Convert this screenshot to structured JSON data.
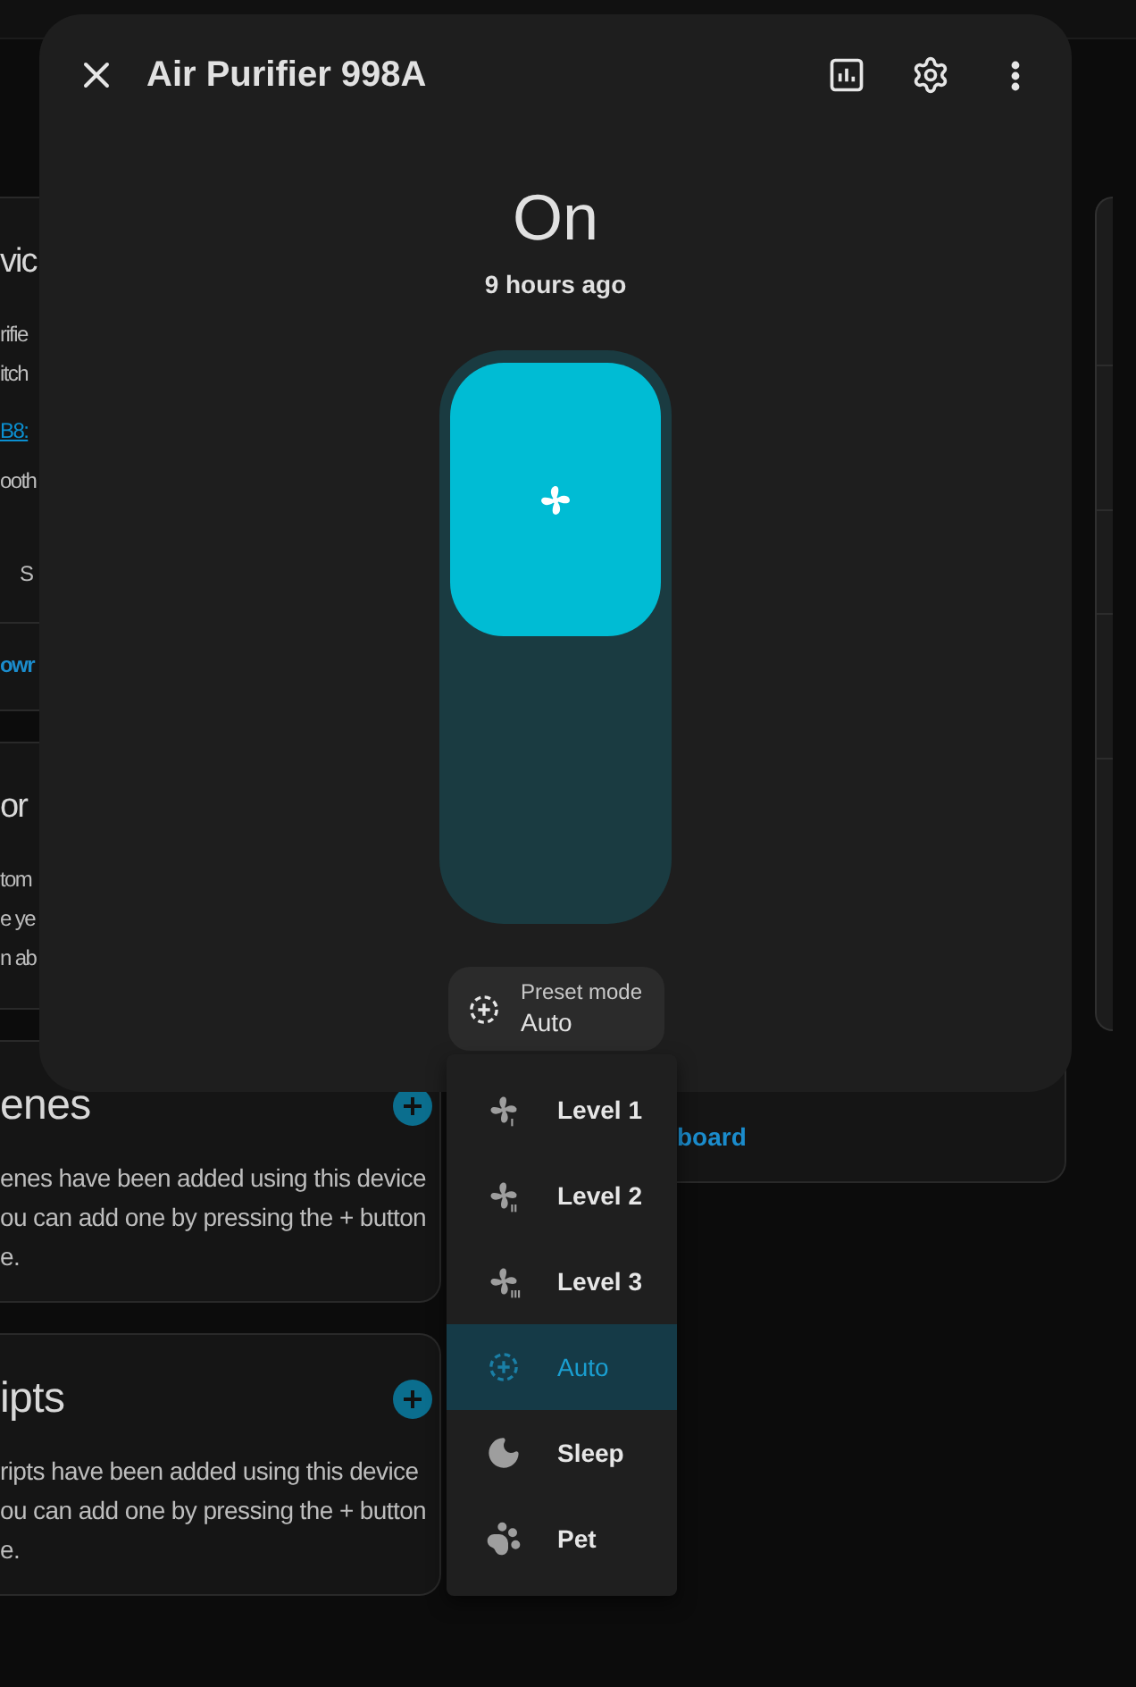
{
  "dialog": {
    "title": "Air Purifier 998A"
  },
  "state": {
    "value": "On",
    "changed": "9 hours ago"
  },
  "control": {
    "on": true
  },
  "preset": {
    "label": "Preset mode",
    "value": "Auto"
  },
  "preset_menu": {
    "items": [
      {
        "label": "Level 1",
        "kind": "speed1",
        "selected": false
      },
      {
        "label": "Level 2",
        "kind": "speed2",
        "selected": false
      },
      {
        "label": "Level 3",
        "kind": "speed3",
        "selected": false
      },
      {
        "label": "Auto",
        "kind": "auto",
        "selected": true
      },
      {
        "label": "Sleep",
        "kind": "sleep",
        "selected": false
      },
      {
        "label": "Pet",
        "kind": "pet",
        "selected": false
      }
    ]
  },
  "background": {
    "left_cards": [
      {
        "heading": "vic",
        "lines": [
          {
            "kind": "text",
            "text": "rifie"
          },
          {
            "kind": "text",
            "text": "itch"
          },
          {
            "kind": "link",
            "text": "B8:"
          },
          {
            "kind": "text",
            "text": "ooth"
          },
          {
            "kind": "label",
            "text": "S"
          }
        ],
        "action": "owr"
      },
      {
        "heading": "or",
        "lines": [
          {
            "kind": "text",
            "text": "tom"
          },
          {
            "kind": "text",
            "text": "e ye"
          },
          {
            "kind": "text",
            "text": "n ab"
          }
        ]
      },
      {
        "heading": "enes",
        "add_button": true,
        "lines": [
          {
            "kind": "text",
            "text": "enes have been added using this device"
          },
          {
            "kind": "text",
            "text": "ou can add one by pressing the + button"
          },
          {
            "kind": "text",
            "text": "e."
          }
        ]
      },
      {
        "heading": "ipts",
        "add_button": true,
        "lines": [
          {
            "kind": "text",
            "text": "ripts have been added using this device"
          },
          {
            "kind": "text",
            "text": "ou can add one by pressing the + button"
          },
          {
            "kind": "text",
            "text": "e."
          }
        ]
      }
    ],
    "middle_card": {
      "link": "board"
    }
  }
}
